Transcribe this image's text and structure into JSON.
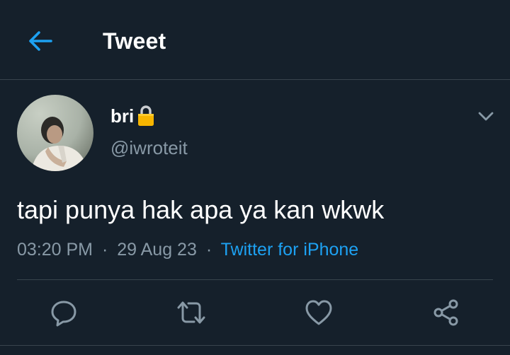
{
  "header": {
    "title": "Tweet",
    "back_icon": "arrow-left-icon"
  },
  "tweet": {
    "author": {
      "display_name": "bri",
      "protected_icon": "lock-icon",
      "handle": "@iwroteit"
    },
    "text": "tapi punya hak apa ya kan wkwk",
    "time": "03:20 PM",
    "date": "29 Aug 23",
    "separator": "·",
    "source": "Twitter for iPhone"
  },
  "actions": [
    {
      "name": "reply",
      "icon": "reply-icon"
    },
    {
      "name": "retweet",
      "icon": "retweet-icon"
    },
    {
      "name": "like",
      "icon": "heart-icon"
    },
    {
      "name": "share",
      "icon": "share-icon"
    }
  ],
  "colors": {
    "background": "#15202b",
    "accent": "#1da1f2",
    "secondary_text": "#8899a6",
    "divider": "#38444d"
  }
}
